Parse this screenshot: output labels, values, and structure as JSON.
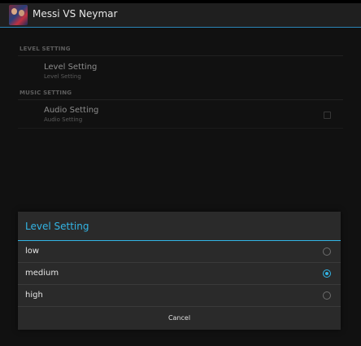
{
  "app": {
    "title": "Messi VS Neymar"
  },
  "preferences": {
    "level_category": "LEVEL SETTING",
    "level_item": {
      "title": "Level Setting",
      "summary": "Level Setting"
    },
    "music_category": "MUSIC SETTING",
    "audio_item": {
      "title": "Audio Setting",
      "summary": "Audio Setting",
      "checked": false
    }
  },
  "dialog": {
    "title": "Level Setting",
    "options": [
      {
        "label": "low",
        "selected": false
      },
      {
        "label": "medium",
        "selected": true
      },
      {
        "label": "high",
        "selected": false
      }
    ],
    "cancel_label": "Cancel"
  },
  "colors": {
    "accent": "#33b5e5",
    "background": "#1b1b1b",
    "dialog": "#2a2a2a"
  }
}
